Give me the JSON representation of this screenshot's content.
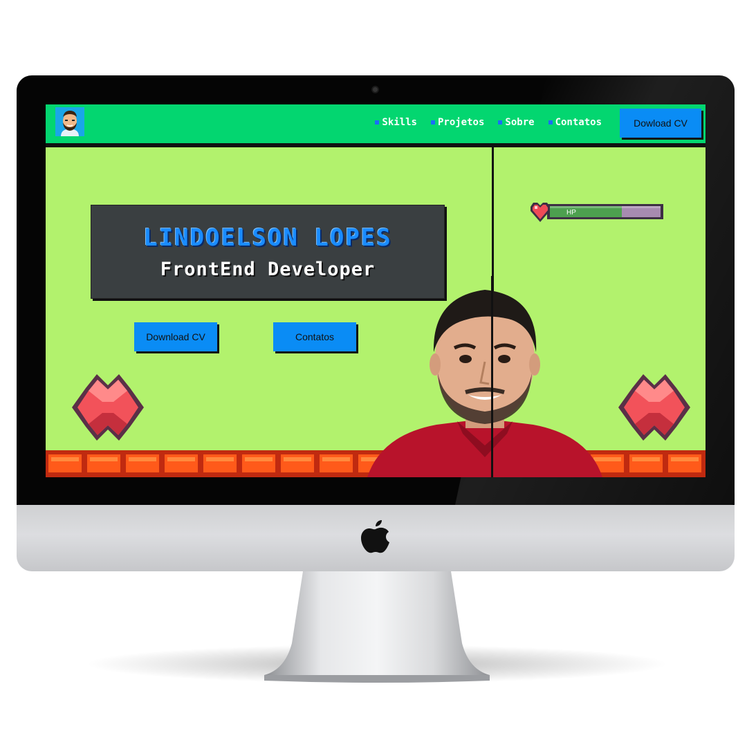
{
  "site": {
    "nav": {
      "items": [
        {
          "label": "Skills"
        },
        {
          "label": "Projetos"
        },
        {
          "label": "Sobre"
        },
        {
          "label": "Contatos"
        }
      ],
      "cv_button": "Dowload CV"
    },
    "hero": {
      "name": "LINDOELSON LOPES",
      "role": "FrontEnd Developer",
      "buttons": {
        "download_cv": "Download CV",
        "contacts": "Contatos"
      }
    },
    "hp_bar": {
      "label": "HP",
      "level": 0.65
    }
  },
  "colors": {
    "navbar": "#03d670",
    "page_background": "#b2f26d",
    "button": "#0a8cf5",
    "title_box": "#3a3f41",
    "name_text": "#1a8cff"
  },
  "icons": [
    "avatar-memoji",
    "apple-logo-icon",
    "heart-icon",
    "gem-icon"
  ]
}
